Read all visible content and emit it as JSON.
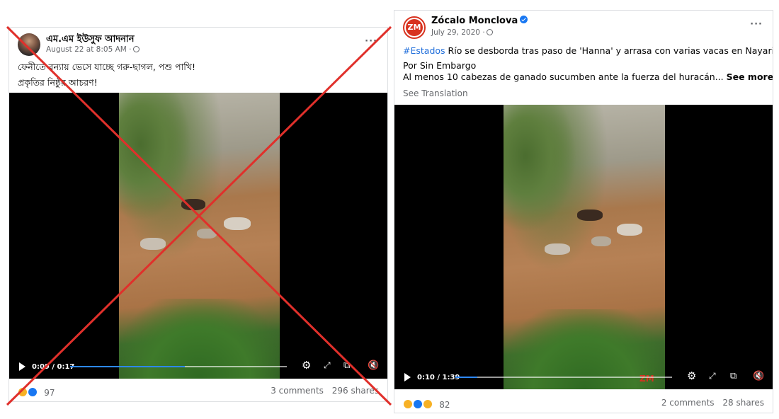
{
  "left_post": {
    "author": "এম.এম ইউসুফ আদনান",
    "date": "August 22 at 8:05 AM ·",
    "more_label": "···",
    "text_line1": "ফেনীতে বন্যায় ভেসে যাচ্ছে গরু-ছাগল, পশু পাখি!",
    "text_line2": "প্রকৃতির নিষ্ঠুর আচরণ!",
    "video": {
      "time": "0:09 / 0:17",
      "progress": 0.53
    },
    "reaction_count": "97",
    "comments": "3 comments",
    "shares": "296 shares",
    "colors": {
      "cross": "#e0302b",
      "progress": "#2d88ff"
    }
  },
  "right_post": {
    "author": "Zócalo Monclova",
    "avatar_text": "ZM",
    "date": "July 29, 2020 ·",
    "more_label": "···",
    "hashtag": "#Estados",
    "text_line1": "Río se desborda tras paso de 'Hanna' y arrasa con varias vacas en Nayarit",
    "text_line2": "Por Sin Embargo",
    "text_line3": "Al menos 10 cabezas de ganado sucumben ante la fuerza del huracán...",
    "see_more": "See more",
    "see_translation": "See Translation",
    "video": {
      "time": "0:10 / 1:39",
      "progress": 0.1
    },
    "watermark": "ZM",
    "reaction_count": "82",
    "comments": "2 comments",
    "shares": "28 shares",
    "colors": {
      "hashtag": "#216fdb",
      "avatar_bg": "#d8321f",
      "verified": "#1877f2"
    }
  },
  "icons": [
    "play-icon",
    "settings-icon",
    "fullscreen-icon",
    "picture-in-picture-icon",
    "volume-muted-icon",
    "globe-icon",
    "verified-icon"
  ]
}
